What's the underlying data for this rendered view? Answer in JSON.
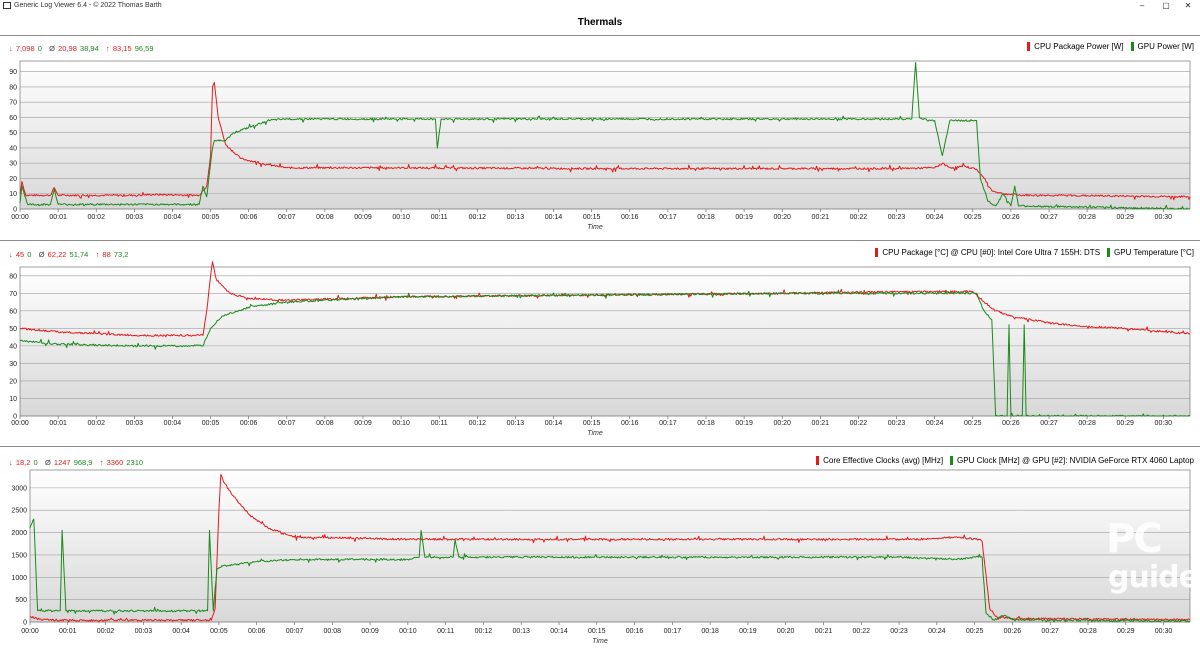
{
  "window": {
    "title": "Generic Log Viewer 6.4 - © 2022 Thomas Barth",
    "minimize": "–",
    "restore": "▢",
    "close": "✕"
  },
  "header": {
    "title": "Thermals"
  },
  "charts": [
    {
      "id": "power",
      "stats": {
        "min_label": "↓",
        "min_a": "7,098",
        "min_b": "0",
        "avg_label": "Ø",
        "avg_a": "20,98",
        "avg_b": "38,94",
        "max_label": "↑",
        "max_a": "83,15",
        "max_b": "96,59"
      },
      "legend": [
        {
          "name": "CPU Package Power [W]",
          "color": "#e41a1c"
        },
        {
          "name": "GPU Power [W]",
          "color": "#1a8a1a"
        }
      ],
      "xlabel": "Time",
      "yticks": [
        "0",
        "10",
        "20",
        "30",
        "40",
        "50",
        "60",
        "70",
        "80",
        "90"
      ]
    },
    {
      "id": "temps",
      "stats": {
        "min_label": "↓",
        "min_a": "45",
        "min_b": "0",
        "avg_label": "Ø",
        "avg_a": "62,22",
        "avg_b": "51,74",
        "max_label": "↑",
        "max_a": "88",
        "max_b": "73,2"
      },
      "legend": [
        {
          "name": "CPU Package [°C] @ CPU [#0]: Intel Core Ultra 7 155H: DTS",
          "color": "#e41a1c"
        },
        {
          "name": "GPU Temperature [°C]",
          "color": "#1a8a1a"
        }
      ],
      "xlabel": "Time",
      "yticks": [
        "0",
        "10",
        "20",
        "30",
        "40",
        "50",
        "60",
        "70",
        "80"
      ]
    },
    {
      "id": "clocks",
      "stats": {
        "min_label": "↓",
        "min_a": "18,2",
        "min_b": "0",
        "avg_label": "Ø",
        "avg_a": "1247",
        "avg_b": "968,9",
        "max_label": "↑",
        "max_a": "3360",
        "max_b": "2310"
      },
      "legend": [
        {
          "name": "Core Effective Clocks (avg) [MHz]",
          "color": "#e41a1c"
        },
        {
          "name": "GPU Clock [MHz] @ GPU [#2]: NVIDIA GeForce RTX 4060 Laptop",
          "color": "#1a8a1a"
        }
      ],
      "xlabel": "Time",
      "yticks": [
        "0",
        "500",
        "1000",
        "1500",
        "2000",
        "2500",
        "3000"
      ]
    }
  ],
  "xticks": [
    "00:00",
    "00:01",
    "00:02",
    "00:03",
    "00:04",
    "00:05",
    "00:06",
    "00:07",
    "00:08",
    "00:09",
    "00:10",
    "00:11",
    "00:12",
    "00:13",
    "00:14",
    "00:15",
    "00:16",
    "00:17",
    "00:18",
    "00:19",
    "00:20",
    "00:21",
    "00:22",
    "00:23",
    "00:24",
    "00:25",
    "00:26",
    "00:27",
    "00:28",
    "00:29",
    "00:30"
  ],
  "chart_data": [
    {
      "type": "line",
      "ylim": [
        0,
        97
      ],
      "xlim_minutes": [
        0,
        30.7
      ],
      "series": [
        {
          "name": "CPU Package Power [W]",
          "color": "#e41a1c",
          "points": [
            [
              0,
              10
            ],
            [
              0.05,
              18
            ],
            [
              0.15,
              9
            ],
            [
              0.8,
              9
            ],
            [
              0.9,
              14
            ],
            [
              1.0,
              9
            ],
            [
              3,
              9
            ],
            [
              3.5,
              9.5
            ],
            [
              4.7,
              9
            ],
            [
              4.8,
              12
            ],
            [
              4.9,
              15
            ],
            [
              5.0,
              35
            ],
            [
              5.05,
              80
            ],
            [
              5.1,
              83
            ],
            [
              5.2,
              60
            ],
            [
              5.4,
              42
            ],
            [
              5.8,
              33
            ],
            [
              6.5,
              29
            ],
            [
              7,
              27
            ],
            [
              10,
              27
            ],
            [
              15,
              26.5
            ],
            [
              20,
              26.5
            ],
            [
              23,
              26.5
            ],
            [
              24,
              27
            ],
            [
              24.2,
              30
            ],
            [
              24.4,
              27
            ],
            [
              24.8,
              28
            ],
            [
              25.1,
              26
            ],
            [
              25.3,
              20
            ],
            [
              25.5,
              12
            ],
            [
              25.8,
              10
            ],
            [
              26.3,
              9
            ],
            [
              27,
              9
            ],
            [
              30.7,
              8
            ]
          ]
        },
        {
          "name": "GPU Power [W]",
          "color": "#1a8a1a",
          "points": [
            [
              0,
              4
            ],
            [
              0.05,
              15
            ],
            [
              0.2,
              3
            ],
            [
              0.8,
              3
            ],
            [
              0.9,
              13
            ],
            [
              1.0,
              3
            ],
            [
              4.7,
              3
            ],
            [
              4.8,
              15
            ],
            [
              4.9,
              8
            ],
            [
              5.05,
              40
            ],
            [
              5.1,
              45
            ],
            [
              5.4,
              45
            ],
            [
              5.6,
              50
            ],
            [
              6.2,
              55
            ],
            [
              6.5,
              58
            ],
            [
              7,
              59
            ],
            [
              8,
              59
            ],
            [
              10.9,
              59
            ],
            [
              10.95,
              40
            ],
            [
              11.05,
              59
            ],
            [
              15,
              59
            ],
            [
              20,
              59
            ],
            [
              23.4,
              59
            ],
            [
              23.5,
              96
            ],
            [
              23.6,
              60
            ],
            [
              23.8,
              58
            ],
            [
              24,
              58
            ],
            [
              24.2,
              35
            ],
            [
              24.4,
              58
            ],
            [
              25,
              58
            ],
            [
              25.1,
              58
            ],
            [
              25.2,
              20
            ],
            [
              25.4,
              5
            ],
            [
              25.6,
              2
            ],
            [
              25.8,
              10
            ],
            [
              26,
              2
            ],
            [
              26.1,
              15
            ],
            [
              26.2,
              2
            ],
            [
              30.7,
              0
            ]
          ]
        }
      ]
    },
    {
      "type": "line",
      "ylim": [
        0,
        85
      ],
      "xlim_minutes": [
        0,
        30.7
      ],
      "series": [
        {
          "name": "CPU Package [°C] @ CPU [#0]: Intel Core Ultra 7 155H: DTS",
          "color": "#e41a1c",
          "points": [
            [
              0,
              50
            ],
            [
              1,
              48
            ],
            [
              2,
              47
            ],
            [
              3,
              46
            ],
            [
              4.8,
              46
            ],
            [
              4.9,
              60
            ],
            [
              5.0,
              80
            ],
            [
              5.05,
              88
            ],
            [
              5.15,
              78
            ],
            [
              5.5,
              70
            ],
            [
              6,
              67
            ],
            [
              7,
              66
            ],
            [
              10,
              68
            ],
            [
              15,
              69
            ],
            [
              20,
              70
            ],
            [
              23.5,
              71
            ],
            [
              25,
              71
            ],
            [
              25.3,
              65
            ],
            [
              25.6,
              60
            ],
            [
              26,
              57
            ],
            [
              27,
              53
            ],
            [
              28,
              51
            ],
            [
              29,
              50
            ],
            [
              30,
              48
            ],
            [
              30.7,
              47
            ]
          ]
        },
        {
          "name": "GPU Temperature [°C]",
          "color": "#1a8a1a",
          "points": [
            [
              0,
              43
            ],
            [
              1,
              41
            ],
            [
              3,
              40
            ],
            [
              4.8,
              40
            ],
            [
              5.0,
              50
            ],
            [
              5.3,
              57
            ],
            [
              6,
              62
            ],
            [
              7,
              65
            ],
            [
              10,
              68
            ],
            [
              15,
              69
            ],
            [
              20,
              70
            ],
            [
              24,
              70
            ],
            [
              25.1,
              70
            ],
            [
              25.3,
              60
            ],
            [
              25.5,
              55
            ],
            [
              25.6,
              0
            ],
            [
              25.9,
              0
            ],
            [
              25.95,
              52
            ],
            [
              26.0,
              0
            ],
            [
              26.3,
              0
            ],
            [
              26.35,
              52
            ],
            [
              26.4,
              0
            ],
            [
              30.7,
              0
            ]
          ]
        }
      ]
    },
    {
      "type": "line",
      "ylim": [
        0,
        3400
      ],
      "xlim_minutes": [
        0,
        30.7
      ],
      "series": [
        {
          "name": "Core Effective Clocks (avg) [MHz]",
          "color": "#e41a1c",
          "points": [
            [
              0,
              120
            ],
            [
              0.3,
              50
            ],
            [
              1,
              40
            ],
            [
              4.8,
              40
            ],
            [
              4.9,
              300
            ],
            [
              5.0,
              2500
            ],
            [
              5.05,
              3300
            ],
            [
              5.15,
              3100
            ],
            [
              5.4,
              2800
            ],
            [
              5.8,
              2400
            ],
            [
              6.3,
              2100
            ],
            [
              7,
              1900
            ],
            [
              10,
              1850
            ],
            [
              15,
              1850
            ],
            [
              20,
              1850
            ],
            [
              23.5,
              1850
            ],
            [
              24.5,
              1900
            ],
            [
              25.1,
              1850
            ],
            [
              25.2,
              1800
            ],
            [
              25.4,
              300
            ],
            [
              25.6,
              100
            ],
            [
              26,
              80
            ],
            [
              30.7,
              50
            ]
          ]
        },
        {
          "name": "GPU Clock [MHz] @ GPU [#2]: NVIDIA GeForce RTX 4060 Laptop",
          "color": "#1a8a1a",
          "points": [
            [
              0,
              2100
            ],
            [
              0.1,
              2300
            ],
            [
              0.2,
              250
            ],
            [
              0.8,
              250
            ],
            [
              0.85,
              2050
            ],
            [
              0.95,
              250
            ],
            [
              4.7,
              250
            ],
            [
              4.75,
              2050
            ],
            [
              4.85,
              250
            ],
            [
              4.95,
              1200
            ],
            [
              5.1,
              1250
            ],
            [
              6,
              1350
            ],
            [
              7,
              1400
            ],
            [
              10,
              1400
            ],
            [
              10.3,
              1450
            ],
            [
              10.35,
              2050
            ],
            [
              10.45,
              1450
            ],
            [
              11.2,
              1450
            ],
            [
              11.25,
              1850
            ],
            [
              11.35,
              1450
            ],
            [
              15,
              1450
            ],
            [
              20,
              1450
            ],
            [
              23,
              1450
            ],
            [
              24.5,
              1400
            ],
            [
              25.1,
              1450
            ],
            [
              25.2,
              1450
            ],
            [
              25.3,
              200
            ],
            [
              25.5,
              50
            ],
            [
              25.8,
              150
            ],
            [
              26,
              50
            ],
            [
              30.7,
              20
            ]
          ]
        }
      ]
    }
  ],
  "watermark": {
    "brand_top": "PC",
    "brand_bottom": "guide."
  }
}
